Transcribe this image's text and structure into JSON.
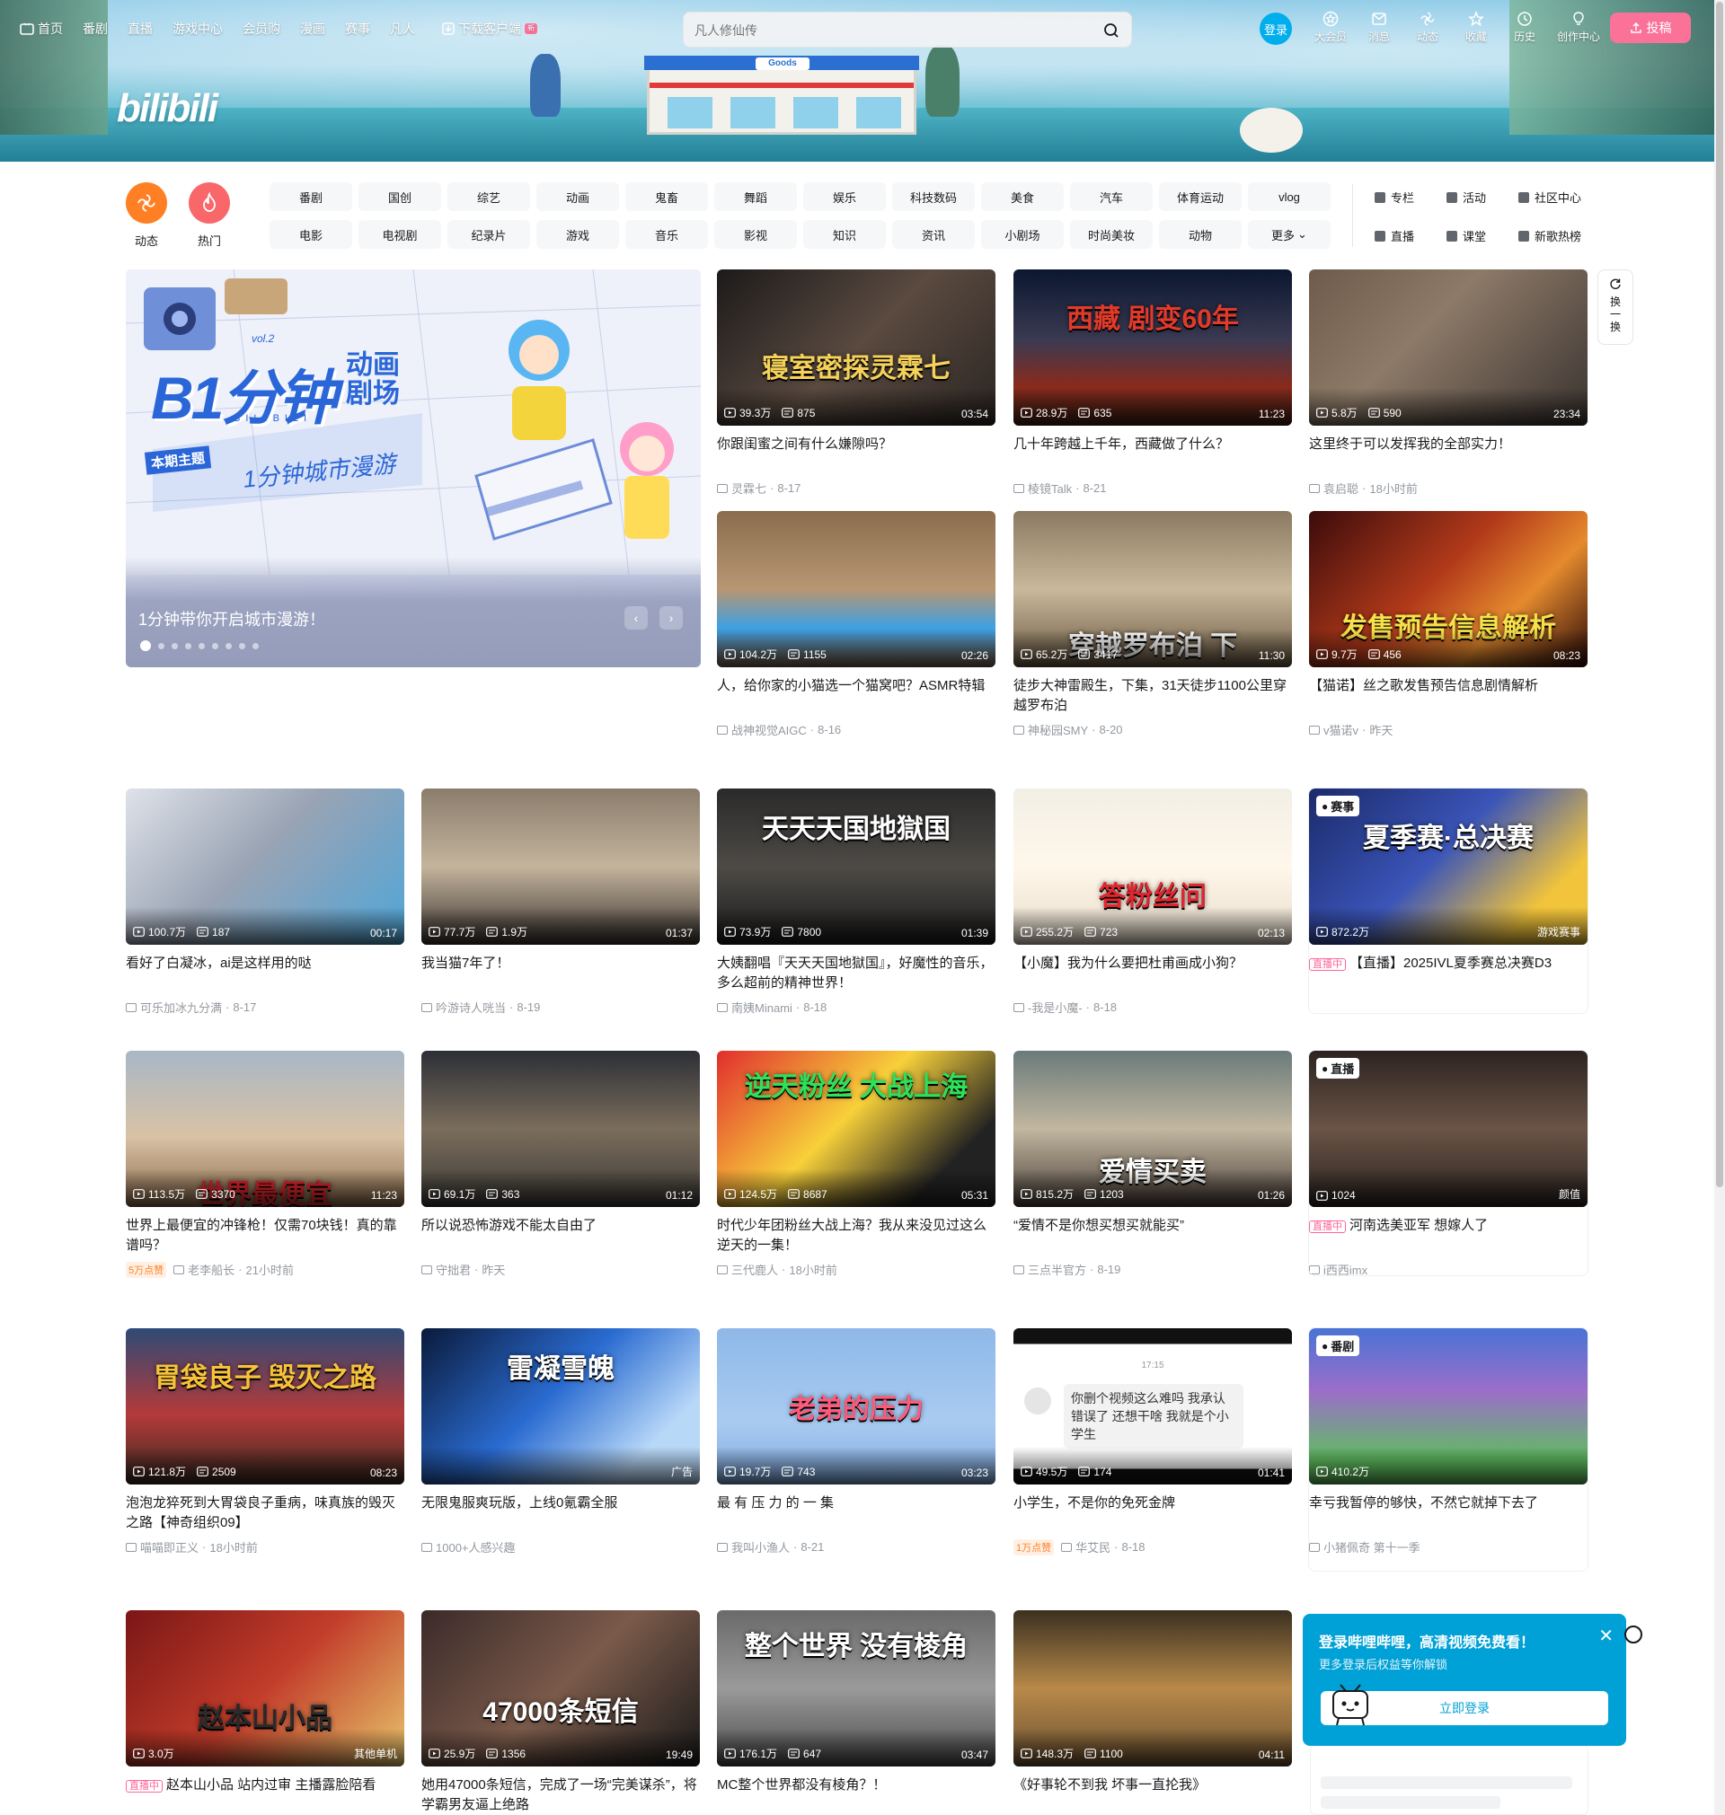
{
  "nav": {
    "items": [
      "首页",
      "番剧",
      "直播",
      "游戏中心",
      "会员购",
      "漫画",
      "赛事",
      "凡人"
    ],
    "download": "下载客户端",
    "download_badge": "新",
    "search_placeholder": "凡人修仙传",
    "login": "登录",
    "right": [
      "大会员",
      "消息",
      "动态",
      "收藏",
      "历史",
      "创作中心"
    ],
    "upload": "投稿"
  },
  "banner": {
    "logo": "bilibili",
    "store_sign": "Goods"
  },
  "channels": {
    "circles": [
      {
        "label": "动态",
        "color": "#ff7f24"
      },
      {
        "label": "热门",
        "color": "#f9676b"
      }
    ],
    "chips": [
      "番剧",
      "国创",
      "综艺",
      "动画",
      "鬼畜",
      "舞蹈",
      "娱乐",
      "科技数码",
      "美食",
      "汽车",
      "体育运动",
      "vlog",
      "电影",
      "电视剧",
      "纪录片",
      "游戏",
      "音乐",
      "影视",
      "知识",
      "资讯",
      "小剧场",
      "时尚美妆",
      "动物",
      "更多"
    ],
    "side": [
      "专栏",
      "活动",
      "社区中心",
      "直播",
      "课堂",
      "新歌热榜"
    ]
  },
  "carousel": {
    "title": "1分钟带你开启城市漫游！",
    "art_title": "B1分钟",
    "art_sub1": "动画",
    "art_sub2": "剧场",
    "art_theme": "本期主题",
    "art_slogan": "1分钟城市漫游",
    "art_vol": "vol.2",
    "art_brand": "BILIBILI"
  },
  "refresh": {
    "label1": "换",
    "label2": "一",
    "label3": "换"
  },
  "cards": [
    {
      "title": "你跟闺蜜之间有什么嫌隙吗？",
      "views": "39.3万",
      "danmaku": "875",
      "duration": "03:54",
      "author": "灵霖七",
      "date": "8-17",
      "overlay": "寝室密探灵霖七"
    },
    {
      "title": "几十年跨越上千年，西藏做了什么？",
      "views": "28.9万",
      "danmaku": "635",
      "duration": "11:23",
      "author": "棱镜Talk",
      "date": "8-21",
      "overlay": "西藏 剧变60年"
    },
    {
      "title": "这里终于可以发挥我的全部实力！",
      "views": "5.8万",
      "danmaku": "590",
      "duration": "23:34",
      "author": "袁启聪",
      "date": "18小时前",
      "overlay": ""
    },
    {
      "title": "人，给你家的小猫选一个猫窝吧？ASMR特辑",
      "views": "104.2万",
      "danmaku": "1155",
      "duration": "02:26",
      "author": "战神视觉AIGC",
      "date": "8-16",
      "overlay": ""
    },
    {
      "title": "徒步大神雷殿生，下集，31天徒步1100公里穿越罗布泊",
      "views": "65.2万",
      "danmaku": "3417",
      "duration": "11:30",
      "author": "神秘园SMY",
      "date": "8-20",
      "overlay": "穿越罗布泊 下"
    },
    {
      "title": "【猫诺】丝之歌发售预告信息剧情解析",
      "views": "9.7万",
      "danmaku": "456",
      "duration": "08:23",
      "author": "v猫诺v",
      "date": "昨天",
      "overlay": "发售预告信息解析"
    },
    {
      "title": "看好了白凝冰，ai是这样用的哒",
      "views": "100.7万",
      "danmaku": "187",
      "duration": "00:17",
      "author": "可乐加冰九分满",
      "date": "8-17",
      "overlay": ""
    },
    {
      "title": "我当猫7年了！",
      "views": "77.7万",
      "danmaku": "1.9万",
      "duration": "01:37",
      "author": "吟游诗人咣当",
      "date": "8-19",
      "overlay": ""
    },
    {
      "title": "大姨翻唱『天天天国地獄国』，好魔性的音乐，多么超前的精神世界！",
      "views": "73.9万",
      "danmaku": "7800",
      "duration": "01:39",
      "author": "南姨Minami",
      "date": "8-18",
      "overlay": "天天天国地獄国"
    },
    {
      "title": "【小魔】我为什么要把杜甫画成小狗？",
      "views": "255.2万",
      "danmaku": "723",
      "duration": "02:13",
      "author": "-我是小魔-",
      "date": "8-18",
      "overlay": "答粉丝问"
    },
    {
      "title": "【直播】2025IVL夏季赛总决赛D3",
      "views": "872.2万",
      "danmaku": "",
      "duration": "游戏赛事",
      "author": "",
      "date": "",
      "overlay": "夏季赛·总决赛",
      "badge": "赛事",
      "live": "直播中"
    },
    {
      "title": "世界上最便宜的冲锋枪！仅需70块钱！真的靠谱吗？",
      "views": "113.5万",
      "danmaku": "3370",
      "duration": "11:23",
      "author": "老李船长",
      "date": "21小时前",
      "overlay": "世界最便宜",
      "like": "5万点赞"
    },
    {
      "title": "所以说恐怖游戏不能太自由了",
      "views": "69.1万",
      "danmaku": "363",
      "duration": "01:12",
      "author": "守拙君",
      "date": "昨天",
      "overlay": ""
    },
    {
      "title": "时代少年团粉丝大战上海？我从来没见过这么逆天的一集！",
      "views": "124.5万",
      "danmaku": "8687",
      "duration": "05:31",
      "author": "三代鹿人",
      "date": "18小时前",
      "overlay": "逆天粉丝 大战上海"
    },
    {
      "title": "“爱情不是你想买想买就能买”",
      "views": "815.2万",
      "danmaku": "1203",
      "duration": "01:26",
      "author": "三点半官方",
      "date": "8-19",
      "overlay": "爱情买卖"
    },
    {
      "title": "河南选美亚军 想嫁人了",
      "views": "1024",
      "danmaku": "",
      "duration": "颜值",
      "author": "i西西imx",
      "date": "",
      "overlay": "",
      "badge": "直播",
      "live": "直播中"
    },
    {
      "title": "泡泡龙猝死到大胃袋良子重病，味真族的毁灭之路【神奇组织09】",
      "views": "121.8万",
      "danmaku": "2509",
      "duration": "08:23",
      "author": "喵喵即正义",
      "date": "18小时前",
      "overlay": "胃袋良子 毁灭之路"
    },
    {
      "title": "无限鬼服爽玩版，上线0氪霸全服",
      "views": "",
      "danmaku": "",
      "duration": "广告",
      "author": "1000+人感兴趣",
      "date": "",
      "overlay": "雷凝雪魄"
    },
    {
      "title": "最 有 压 力 的 一 集",
      "views": "19.7万",
      "danmaku": "743",
      "duration": "03:23",
      "author": "我叫小渔人",
      "date": "8-21",
      "overlay": "老弟的压力"
    },
    {
      "title": "小学生，不是你的免死金牌",
      "views": "49.5万",
      "danmaku": "174",
      "duration": "01:41",
      "author": "华艾民",
      "date": "8-18",
      "overlay": "",
      "like": "1万点赞"
    },
    {
      "title": "幸亏我暂停的够快，不然它就掉下去了",
      "views": "410.2万",
      "danmaku": "",
      "duration": "",
      "author": "小猪佩奇 第十一季",
      "date": "",
      "overlay": "",
      "badge": "番剧"
    },
    {
      "title": "赵本山小品 站内过审 主播露脸陪看",
      "views": "3.0万",
      "danmaku": "",
      "duration": "其他单机",
      "author": "",
      "date": "",
      "overlay": "赵本山小品",
      "live": "直播中"
    },
    {
      "title": "她用47000条短信，完成了一场“完美谋杀”，将学霸男友逼上绝路",
      "views": "25.9万",
      "danmaku": "1356",
      "duration": "19:49",
      "author": "",
      "date": "",
      "overlay": "47000条短信"
    },
    {
      "title": "MC整个世界都没有棱角？！",
      "views": "176.1万",
      "danmaku": "647",
      "duration": "03:47",
      "author": "",
      "date": "",
      "overlay": "整个世界 没有棱角"
    },
    {
      "title": "《好事轮不到我 坏事一直抡我》",
      "views": "148.3万",
      "danmaku": "1100",
      "duration": "04:11",
      "author": "",
      "date": "",
      "overlay": ""
    }
  ],
  "chat_card": {
    "time": "17:15",
    "bubble": "你删个视频这么难吗 我承认错误了 还想干啥 我就是个小学生"
  },
  "popup": {
    "title": "登录哔哩哔哩，高清视频免费看！",
    "sub": "更多登录后权益等你解锁",
    "button": "立即登录"
  },
  "colors": {
    "accent": "#fb7299",
    "blue": "#00aeec"
  }
}
